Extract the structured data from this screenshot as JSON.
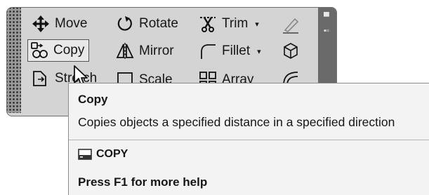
{
  "ribbon": {
    "tools": {
      "move": {
        "label": "Move",
        "icon": "move-icon"
      },
      "rotate": {
        "label": "Rotate",
        "icon": "rotate-icon"
      },
      "trim": {
        "label": "Trim",
        "icon": "trim-icon",
        "has_dropdown": true
      },
      "copy": {
        "label": "Copy",
        "icon": "copy-icon",
        "state": "hover"
      },
      "mirror": {
        "label": "Mirror",
        "icon": "mirror-icon"
      },
      "fillet": {
        "label": "Fillet",
        "icon": "fillet-icon",
        "has_dropdown": true
      },
      "stretch": {
        "label": "Stretch",
        "icon": "stretch-icon"
      },
      "scale": {
        "label": "Scale",
        "icon": "scale-icon"
      },
      "array": {
        "label": "Array",
        "icon": "array-icon"
      }
    },
    "dropdown_caret": "▾",
    "side_icons": [
      "erase-icon",
      "explode-icon",
      "offset-icon"
    ]
  },
  "tooltip": {
    "title": "Copy",
    "description": "Copies objects a specified distance in a specified direction",
    "command": "COPY",
    "help": "Press F1 for more help"
  },
  "colors": {
    "panel_bg": "#d4d4d4",
    "tooltip_bg": "#f3f3f3",
    "panel_border": "#6e6e6e",
    "hover_bg": "#e8e8e8"
  }
}
